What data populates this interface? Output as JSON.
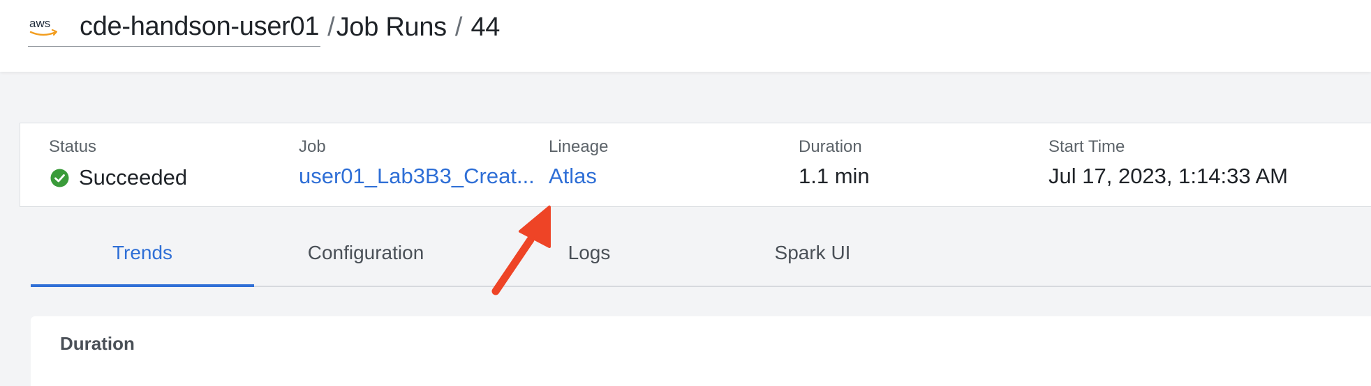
{
  "header": {
    "cloud_logo_text": "aws",
    "environment": "cde-handson-user01",
    "separator": "/",
    "section": "Job Runs",
    "run_id": "44"
  },
  "summary": {
    "status": {
      "label": "Status",
      "value": "Succeeded",
      "icon": "check-circle-icon",
      "color": "#3a9b3a"
    },
    "job": {
      "label": "Job",
      "value": "user01_Lab3B3_Creat..."
    },
    "lineage": {
      "label": "Lineage",
      "value": "Atlas"
    },
    "duration": {
      "label": "Duration",
      "value": "1.1 min"
    },
    "start_time": {
      "label": "Start Time",
      "value": "Jul 17, 2023, 1:14:33 AM"
    }
  },
  "tabs": [
    {
      "label": "Trends",
      "active": true
    },
    {
      "label": "Configuration",
      "active": false
    },
    {
      "label": "Logs",
      "active": false
    },
    {
      "label": "Spark UI",
      "active": false
    }
  ],
  "panel": {
    "title": "Duration"
  },
  "colors": {
    "accent": "#2f6fd6",
    "annotation_arrow": "#ee4426"
  }
}
